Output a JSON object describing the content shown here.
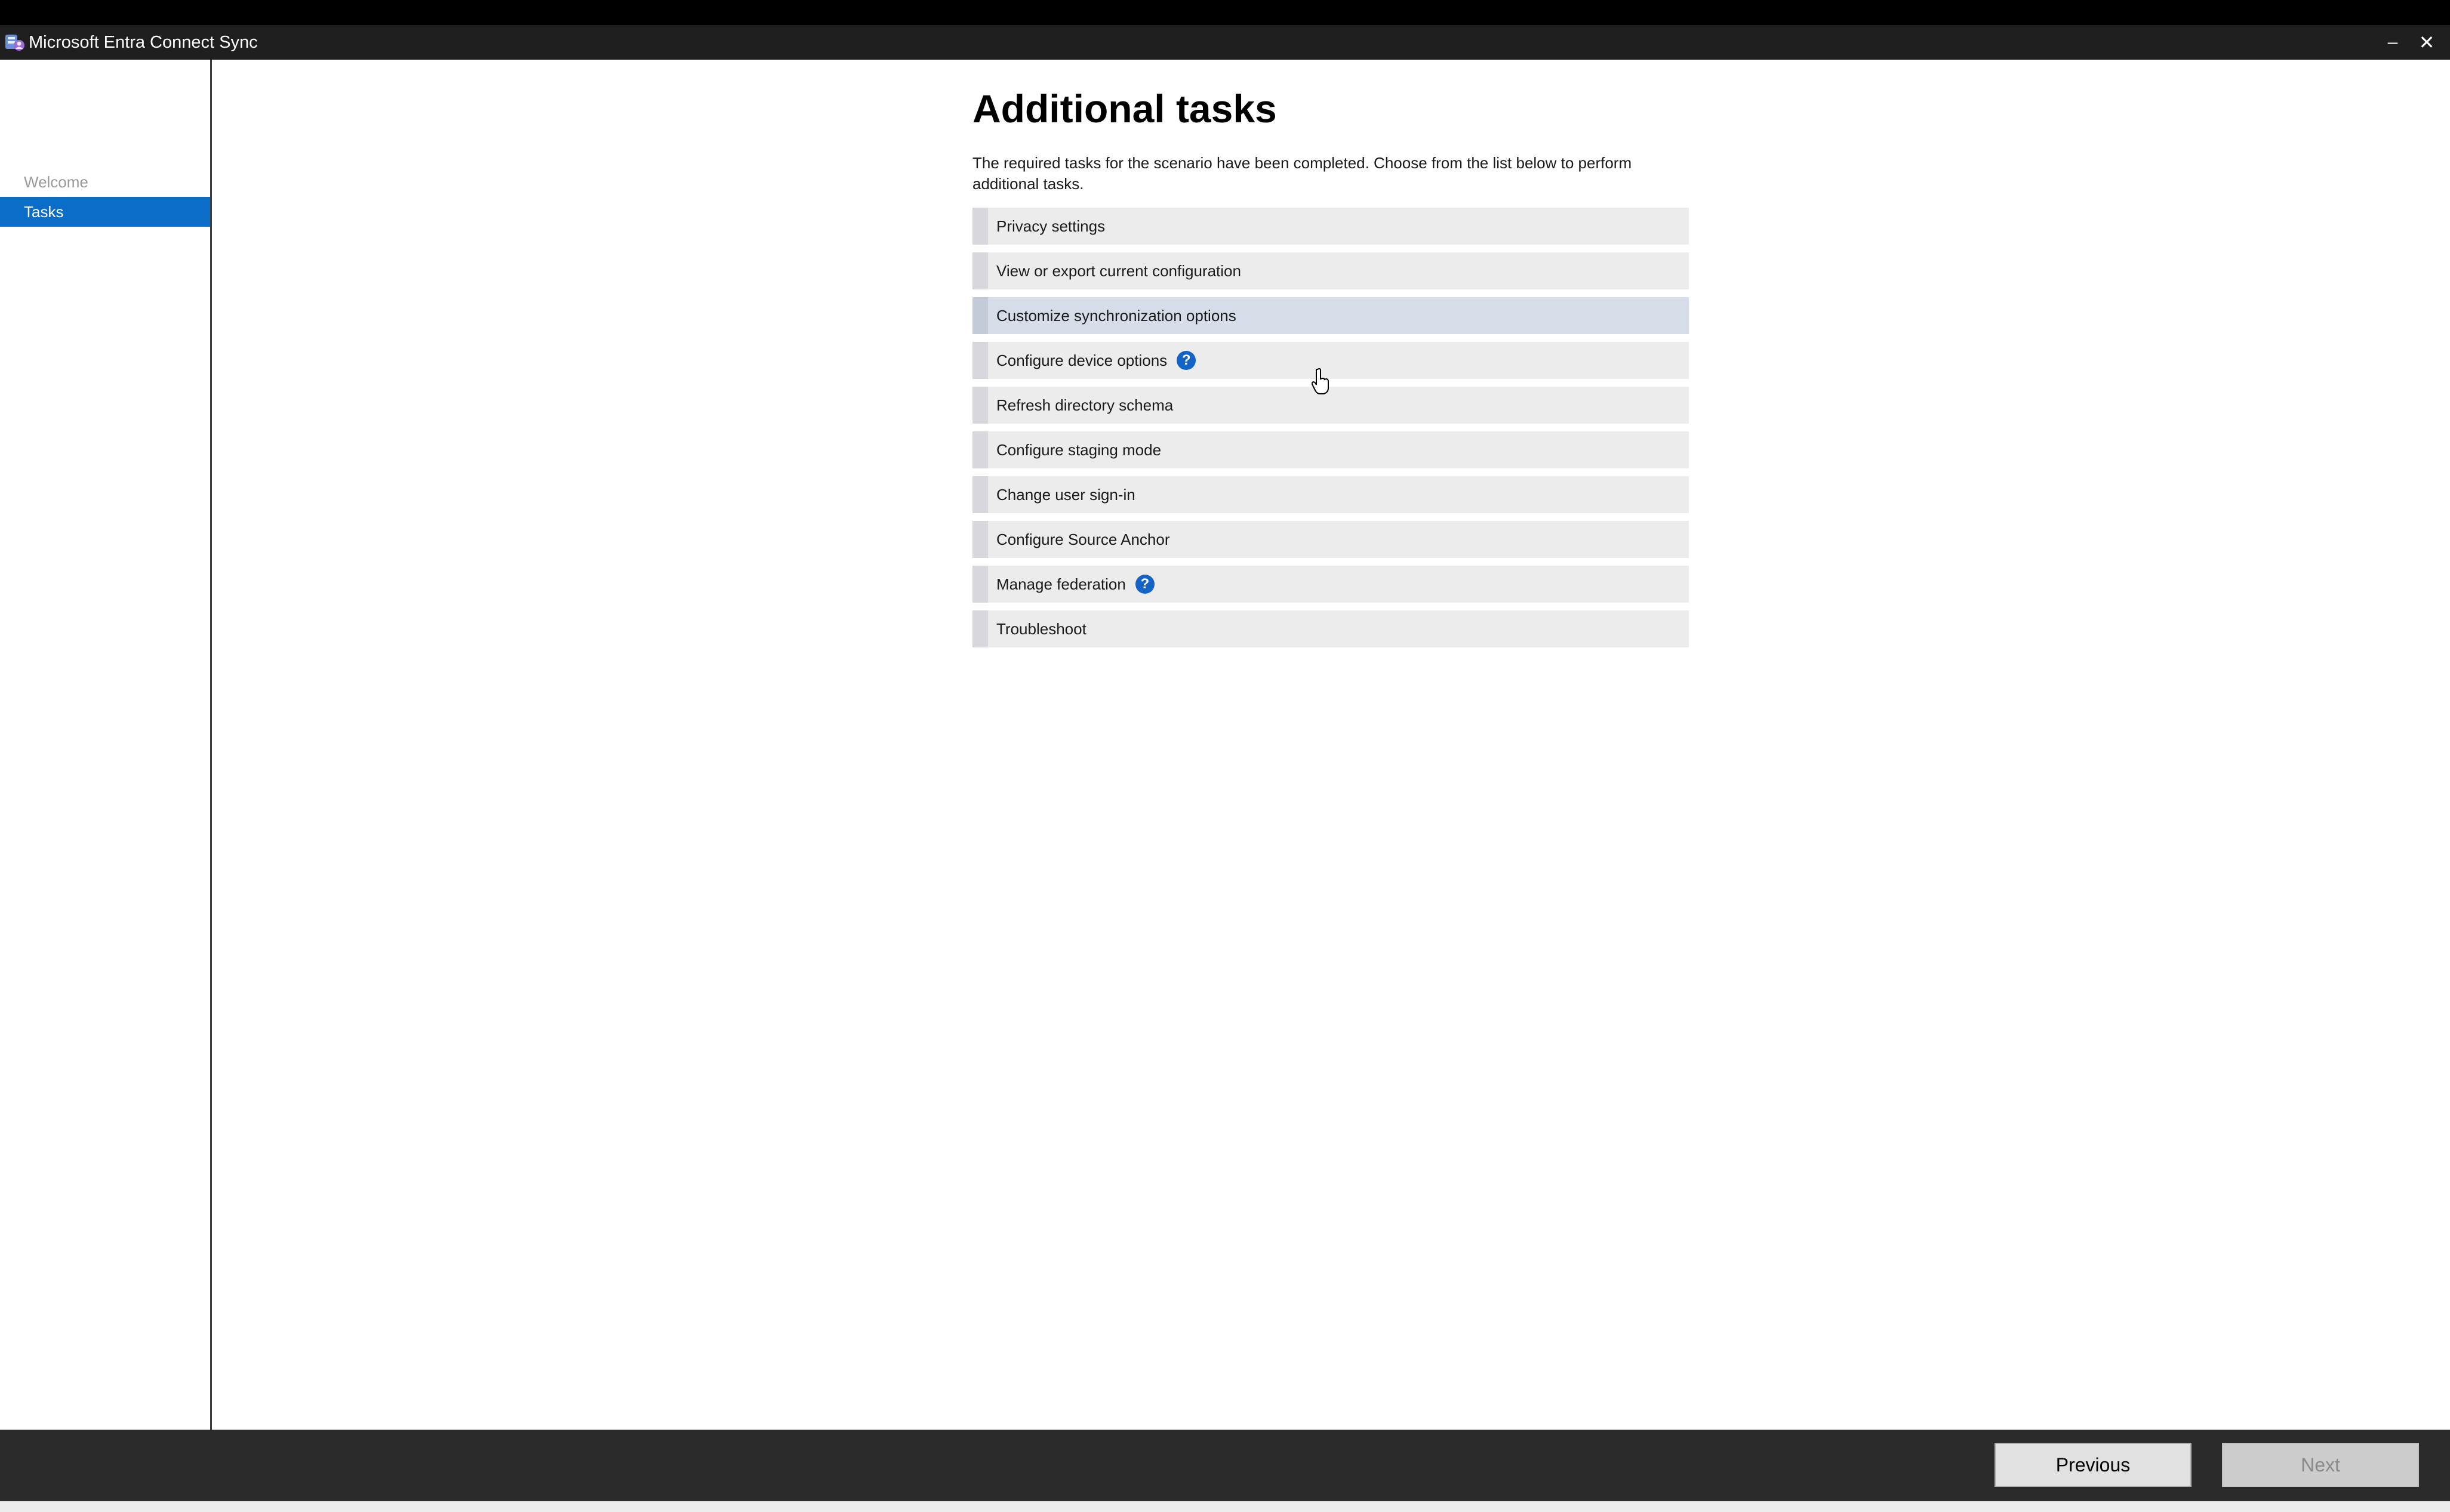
{
  "window": {
    "title": "Microsoft Entra Connect Sync",
    "minimize_glyph": "–",
    "close_glyph": "✕",
    "icon": "entra-connect-app-icon"
  },
  "sidebar": {
    "items": [
      {
        "label": "Welcome",
        "state": "disabled"
      },
      {
        "label": "Tasks",
        "state": "selected"
      }
    ]
  },
  "main": {
    "title": "Additional tasks",
    "description": "The required tasks for the scenario have been completed. Choose from the list below to perform additional tasks.",
    "tasks": [
      {
        "label": "Privacy settings"
      },
      {
        "label": "View or export current configuration"
      },
      {
        "label": "Customize synchronization options",
        "hovered": true
      },
      {
        "label": "Configure device options",
        "help": "?"
      },
      {
        "label": "Refresh directory schema"
      },
      {
        "label": "Configure staging mode"
      },
      {
        "label": "Change user sign-in"
      },
      {
        "label": "Configure Source Anchor"
      },
      {
        "label": "Manage federation",
        "help": "?"
      },
      {
        "label": "Troubleshoot"
      }
    ]
  },
  "footer": {
    "previous_label": "Previous",
    "next_label": "Next",
    "next_enabled": false
  },
  "colors": {
    "selection": "#0a6ec8",
    "help_icon": "#1463c6",
    "hover_row": "#d6dde8"
  }
}
